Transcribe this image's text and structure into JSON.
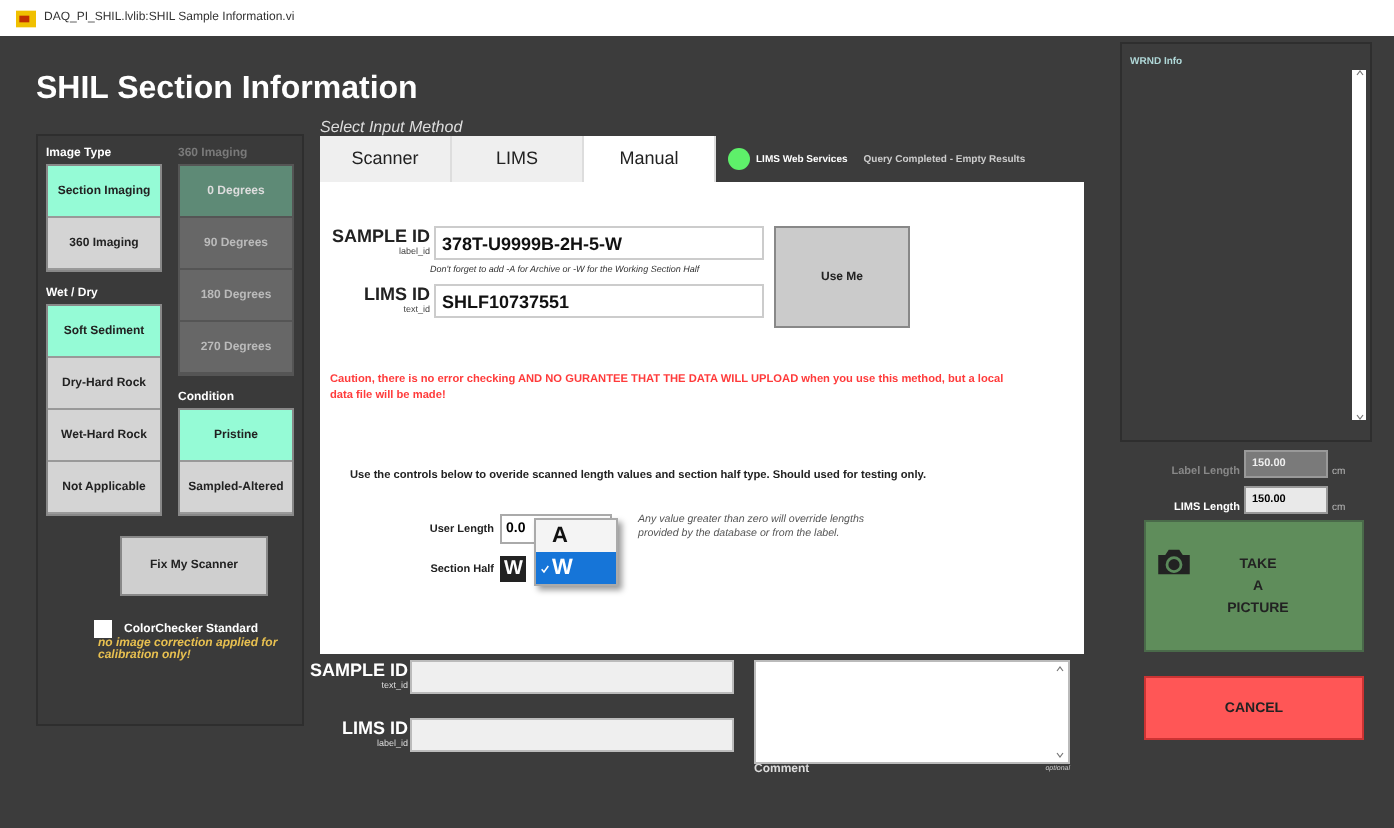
{
  "window": {
    "title": "DAQ_PI_SHIL.lvlib:SHIL Sample Information.vi"
  },
  "heading": "SHIL Section Information",
  "left_panel": {
    "image_type": {
      "label": "Image Type",
      "options": [
        {
          "label": "Section Imaging",
          "selected": true
        },
        {
          "label": "360 Imaging",
          "selected": false
        }
      ]
    },
    "imaging_360": {
      "label": "360 Imaging",
      "disabled": true,
      "options": [
        {
          "label": "0 Degrees",
          "selected": true
        },
        {
          "label": "90 Degrees",
          "selected": false
        },
        {
          "label": "180 Degrees",
          "selected": false
        },
        {
          "label": "270 Degrees",
          "selected": false
        }
      ]
    },
    "wet_dry": {
      "label": "Wet / Dry",
      "options": [
        {
          "label": "Soft Sediment",
          "selected": true
        },
        {
          "label": "Dry-Hard Rock",
          "selected": false
        },
        {
          "label": "Wet-Hard Rock",
          "selected": false
        },
        {
          "label": "Not Applicable",
          "selected": false
        }
      ]
    },
    "condition": {
      "label": "Condition",
      "options": [
        {
          "label": "Pristine",
          "selected": true
        },
        {
          "label": "Sampled-Altered",
          "selected": false
        }
      ]
    },
    "fix_button": "Fix My Scanner",
    "colorchecker": {
      "label": "ColorChecker Standard",
      "checked": false,
      "note": "no image correction applied for calibration only!"
    }
  },
  "input_method": {
    "label": "Select Input Method",
    "tabs": [
      {
        "label": "Scanner",
        "selected": false
      },
      {
        "label": "LIMS",
        "selected": false
      },
      {
        "label": "Manual",
        "selected": true
      }
    ],
    "status": {
      "label": "LIMS Web Services",
      "on": true,
      "message": "Query Completed - Empty Results"
    }
  },
  "manual": {
    "sample_id": {
      "label": "SAMPLE ID",
      "sublabel": "label_id",
      "value": "378T-U9999B-2H-5-W"
    },
    "hint": "Don't forget to add -A for Archive or -W for the Working Section Half",
    "lims_id": {
      "label": "LIMS ID",
      "sublabel": "text_id",
      "value": "SHLF10737551"
    },
    "use_button": "Use Me",
    "caution": "Caution, there is no error checking AND NO GURANTEE THAT THE DATA WILL UPLOAD when you use this method, but a local data file will be made!",
    "override_note": "Use the controls below to overide scanned length values and section half type.  Should used for testing only.",
    "user_length": {
      "label": "User Length",
      "value": "0.0"
    },
    "length_note": "Any value greater than zero will override lengths provided by the database or from the label.",
    "section_half": {
      "label": "Section Half",
      "value": "W",
      "menu": [
        {
          "label": "A",
          "selected": false
        },
        {
          "label": "W",
          "selected": true
        }
      ]
    }
  },
  "bottom": {
    "sample_id": {
      "label": "SAMPLE ID",
      "sublabel": "text_id"
    },
    "lims_id": {
      "label": "LIMS ID",
      "sublabel": "label_id"
    },
    "comment": {
      "label": "Comment",
      "note": "optional"
    }
  },
  "right_panel": {
    "label": "WRND Info",
    "label_length": {
      "label": "Label Length",
      "value": "150.00",
      "unit": "cm",
      "disabled": true
    },
    "lims_length": {
      "label": "LIMS Length",
      "value": "150.00",
      "unit": "cm",
      "disabled": false
    },
    "take_picture": [
      "TAKE",
      "A",
      "PICTURE"
    ],
    "cancel": "CANCEL"
  }
}
